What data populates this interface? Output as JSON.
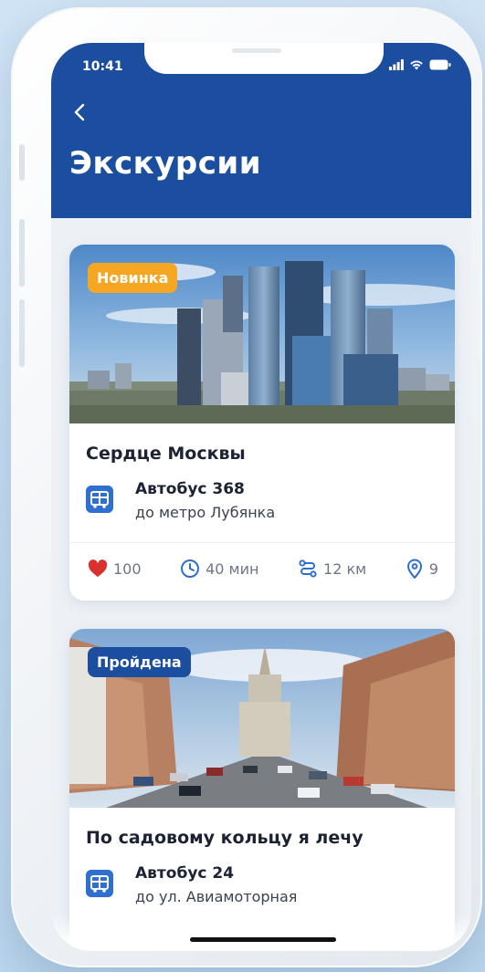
{
  "status_bar": {
    "time": "10:41"
  },
  "header": {
    "title": "Экскурсии"
  },
  "tours": [
    {
      "badge": "Новинка",
      "badge_color": "#f5a623",
      "title": "Сердце Москвы",
      "bus": "Автобус 368",
      "destination": "до метро Лубянка",
      "likes": "100",
      "duration": "40 мин",
      "distance": "12 км",
      "stops": "9"
    },
    {
      "badge": "Пройдена",
      "badge_color": "#1c4ea0",
      "title": "По садовому кольцу я лечу",
      "bus": "Автобус 24",
      "destination": "до ул. Авиамоторная"
    }
  ],
  "colors": {
    "header": "#1c4ea0",
    "accent": "#2f6fcf",
    "like": "#d8312f"
  }
}
